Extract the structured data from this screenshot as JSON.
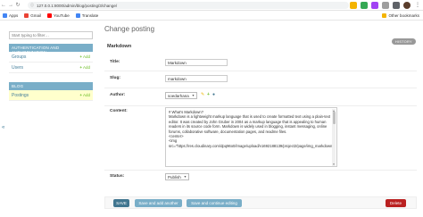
{
  "browser": {
    "back_icon": "←",
    "forward_icon": "→",
    "reload_icon": "↻",
    "url": "127.0.0.1:8000/admin/blog/posting/3/change/",
    "bookmarks": [
      {
        "label": "Apps",
        "icon": "apps-icon",
        "color": "#4285f4"
      },
      {
        "label": "Gmail",
        "icon": "gmail-icon",
        "color": "#ea4335"
      },
      {
        "label": "YouTube",
        "icon": "youtube-icon",
        "color": "#ff0000"
      },
      {
        "label": "Translate",
        "icon": "translate-icon",
        "color": "#4285f4"
      }
    ],
    "other_bookmarks": "Other bookmarks"
  },
  "sidebar": {
    "filter_placeholder": "Start typing to filter…",
    "modules": [
      {
        "title": "AUTHENTICATION AND AUTHORIZATION",
        "rows": [
          {
            "label": "Groups",
            "add": "Add"
          },
          {
            "label": "Users",
            "add": "Add"
          }
        ]
      },
      {
        "title": "BLOG",
        "rows": [
          {
            "label": "Postings",
            "add": "Add",
            "selected": true
          }
        ]
      }
    ],
    "collapse_icon": "«"
  },
  "main": {
    "page_title": "Change posting",
    "history_label": "HISTORY",
    "object_title": "Markdown",
    "fields": {
      "title_label": "Title:",
      "title_value": "Markdown",
      "slug_label": "Slug:",
      "slug_value": "markdown",
      "author_label": "Author:",
      "author_value": "soedarhana",
      "content_label": "Content:",
      "content_lines": [
        "# What's Markdown?",
        "",
        "Markdown is a lightweight markup language that is used to create formatted text using a plain-text",
        "editor. It was created by John Gruber in 2004 as a markup language that is appealing to human",
        "readers in its source code form. Markdown is widely used in blogging, instant messaging, online",
        "forums, collaborative software, documentation pages, and readme files.",
        "",
        "<center>",
        "<img",
        "src=\"https://res.cloudinary.com/dpq96o0/image/upload/v1692188139/project2/page/img_markdown"
      ],
      "status_label": "Status:",
      "status_value": "Publish"
    }
  },
  "submit": {
    "save": "SAVE",
    "save_add_another": "Save and add another",
    "save_continue": "Save and continue editing",
    "delete": "Delete"
  }
}
